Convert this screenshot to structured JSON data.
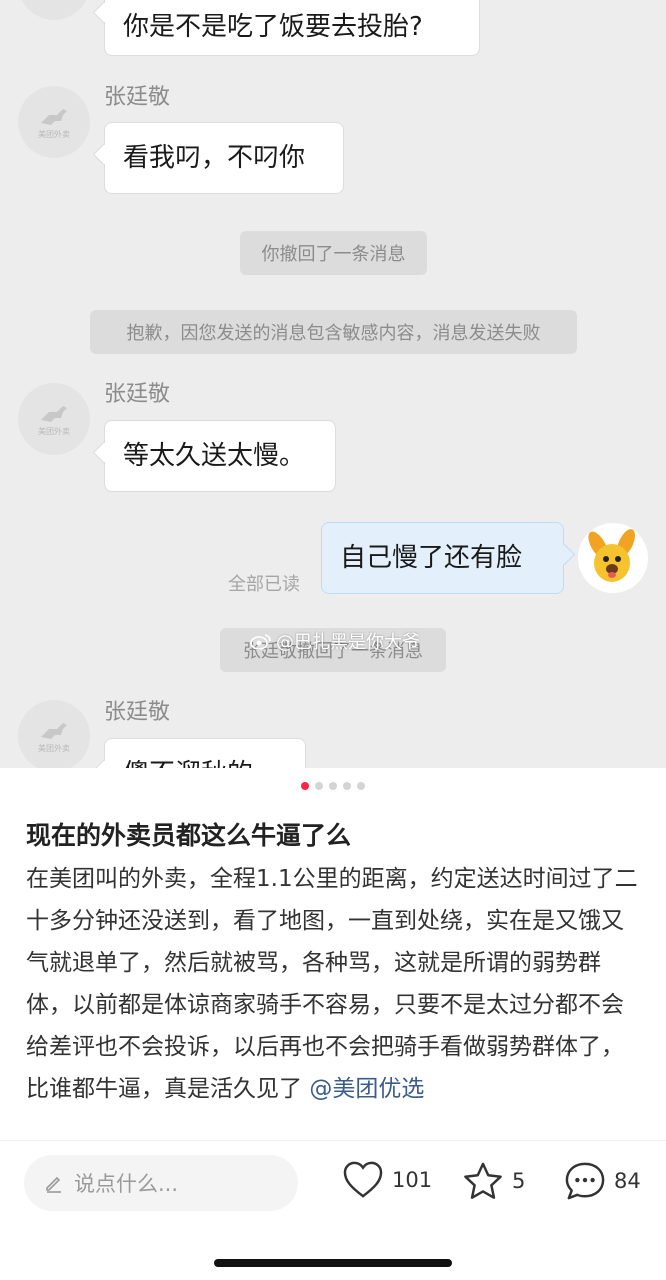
{
  "chat": {
    "avatar_caption": "美团外卖",
    "messages": [
      {
        "type": "incoming",
        "text": "你是不是吃了饭要去投胎?"
      },
      {
        "type": "incoming",
        "sender": "张廷敬",
        "text": "看我叼，不叼你"
      },
      {
        "type": "system",
        "text": "你撤回了一条消息"
      },
      {
        "type": "system",
        "text": "抱歉，因您发送的消息包含敏感内容，消息发送失败"
      },
      {
        "type": "incoming",
        "sender": "张廷敬",
        "text": "等太久送太慢。"
      },
      {
        "type": "outgoing",
        "text": "自己慢了还有脸",
        "status": "全部已读"
      },
      {
        "type": "system",
        "text": "张廷敬撤回了一条消息"
      },
      {
        "type": "incoming",
        "sender": "张廷敬",
        "text": "傻不溜秋的"
      }
    ],
    "watermark": "@巴扎黑是你大爷"
  },
  "pager": {
    "count": 5,
    "active_index": 0
  },
  "post": {
    "title": "现在的外卖员都这么牛逼了么",
    "body": "在美团叫的外卖，全程1.1公里的距离，约定送达时间过了二十多分钟还没送到，看了地图，一直到处绕，实在是又饿又气就退单了，然后就被骂，各种骂，这就是所谓的弱势群体，以前都是体谅商家骑手不容易，只要不是太过分都不会给差评也不会投诉，以后再也不会把骑手看做弱势群体了，比谁都牛逼，真是活久见了",
    "mention": "@美团优选"
  },
  "bottom_bar": {
    "comment_placeholder": "说点什么...",
    "likes": "101",
    "stars": "5",
    "comments": "84"
  },
  "colors": {
    "accent": "#ff2442",
    "mention": "#3b5c8e",
    "chat_bg": "#ededed",
    "outgoing_bubble": "#e3f0fc"
  }
}
